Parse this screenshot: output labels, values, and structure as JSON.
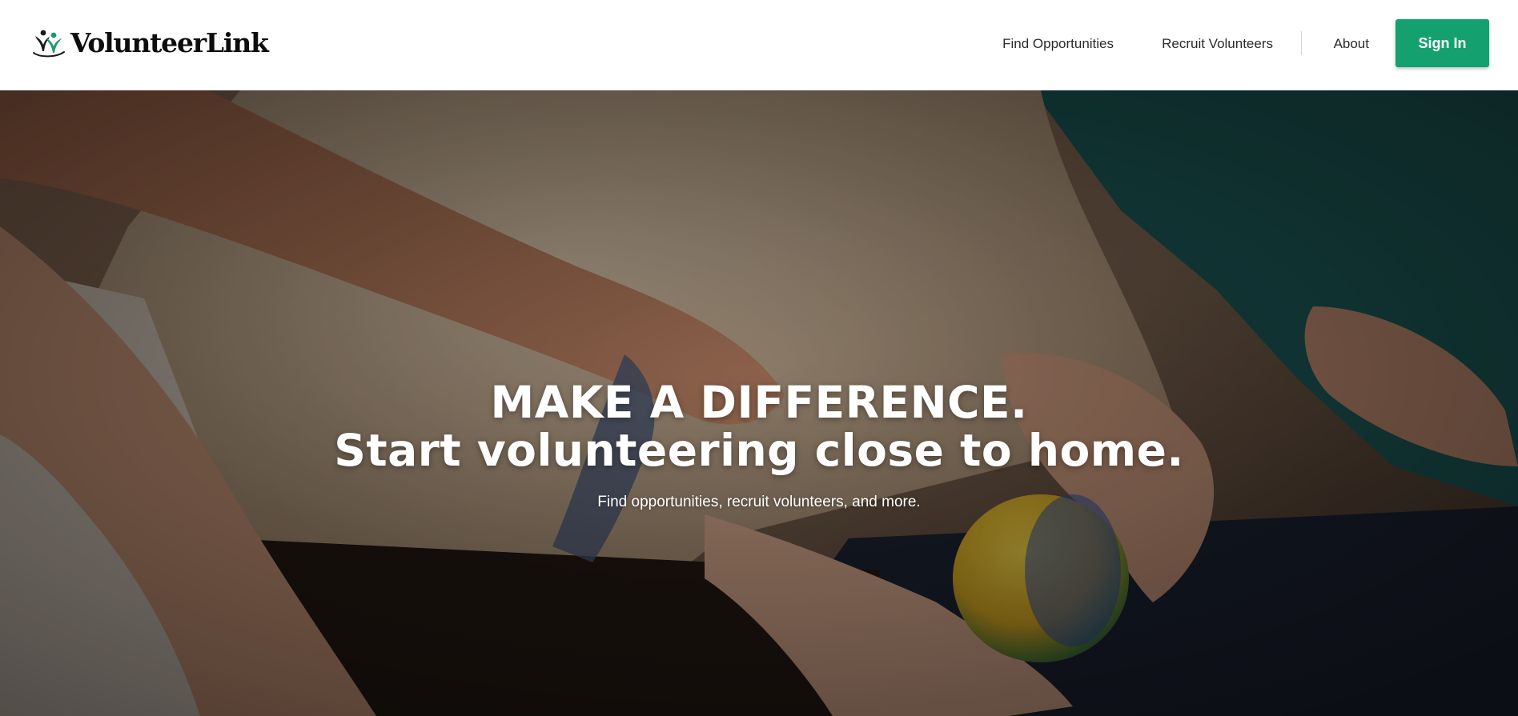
{
  "header": {
    "brand": "VolunteerLink",
    "nav": {
      "find": "Find Opportunities",
      "recruit": "Recruit Volunteers",
      "about": "About"
    },
    "signin": "Sign In"
  },
  "hero": {
    "headline_line1": "MAKE A DIFFERENCE.",
    "headline_line2": "Start volunteering close to home.",
    "subheadline": "Find opportunities, recruit volunteers, and more."
  },
  "colors": {
    "brand_green": "#15a06f",
    "logo_green": "#1b9a6b",
    "text_dark": "#2b2b2b"
  },
  "icons": {
    "logo": "two-people-with-raised-arms-icon"
  }
}
